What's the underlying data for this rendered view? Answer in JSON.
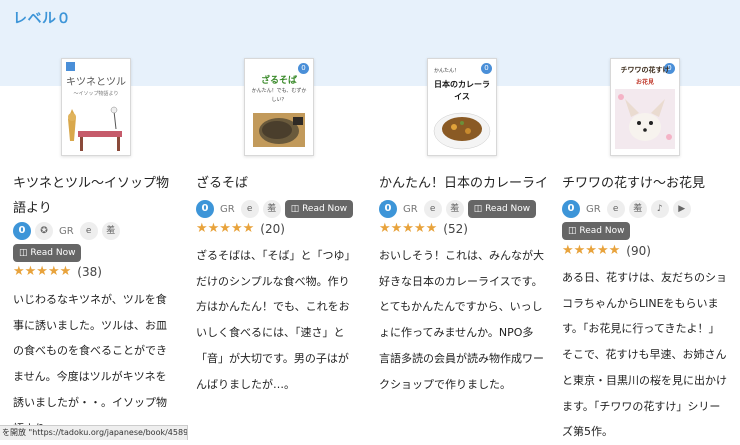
{
  "section": {
    "title": "レベル０"
  },
  "books": [
    {
      "cover_title": "キツネとツル",
      "cover_sub": "～イソップ物語より",
      "cover_level": "0",
      "title": "キツネとツル～イソップ物語より",
      "level": "0",
      "tags": [
        "GR",
        "e",
        "羞"
      ],
      "read_now": "Read Now",
      "stars": "★★★★★",
      "reviews": "(38)",
      "description": "いじわるなキツネが、ツルを食事に誘いました。ツルは、お皿の食べものを食べることができません。今度はツルがキツネを誘いましたが・・。イソップ物語より。"
    },
    {
      "cover_title": "ざるそば",
      "cover_sub": "かんたん！でも、むずかしい？",
      "cover_level": "0",
      "title": "ざるそば",
      "level": "0",
      "tags": [
        "GR",
        "e",
        "羞"
      ],
      "read_now": "Read Now",
      "stars": "★★★★★",
      "reviews": "(20)",
      "description": "ざるそばは、「そば」と「つゆ」だけのシンプルな食べ物。作り方はかんたん！でも、これをおいしく食べるには、「速さ」と「音」が大切です。男の子はがんばりましたが…。"
    },
    {
      "cover_title": "日本のカレーライス",
      "cover_sub": "かんたん！",
      "cover_level": "0",
      "title": "かんたん！日本のカレーライス",
      "level": "0",
      "tags": [
        "GR",
        "e",
        "羞"
      ],
      "read_now": "Read Now",
      "stars": "★★★★★",
      "reviews": "(52)",
      "description": "おいしそう！これは、みんなが大好きな日本のカレーライスです。とてもかんたんですから、いっしょに作ってみませんか。NPO多言語多読の会員が読み物作成ワークショップで作りました。"
    },
    {
      "cover_title": "チワワの花すけ",
      "cover_sub": "お花見",
      "cover_level": "0",
      "title": "チワワの花すけ～お花見",
      "level": "0",
      "tags": [
        "GR",
        "e",
        "羞"
      ],
      "read_now": "Read Now",
      "stars": "★★★★★",
      "reviews": "(90)",
      "description": "ある日、花すけは、友だちのショコラちゃんからLINEをもらいます。「お花見に行ってきたよ！」そこで、花すけも早速、お姉さんと東京・目黒川の桜を見に出かけます。「チワワの花すけ」シリーズ第5作。"
    }
  ],
  "status_bar": {
    "text": "を開放 \"https://tadoku.org/japanese/book/45891/\""
  }
}
